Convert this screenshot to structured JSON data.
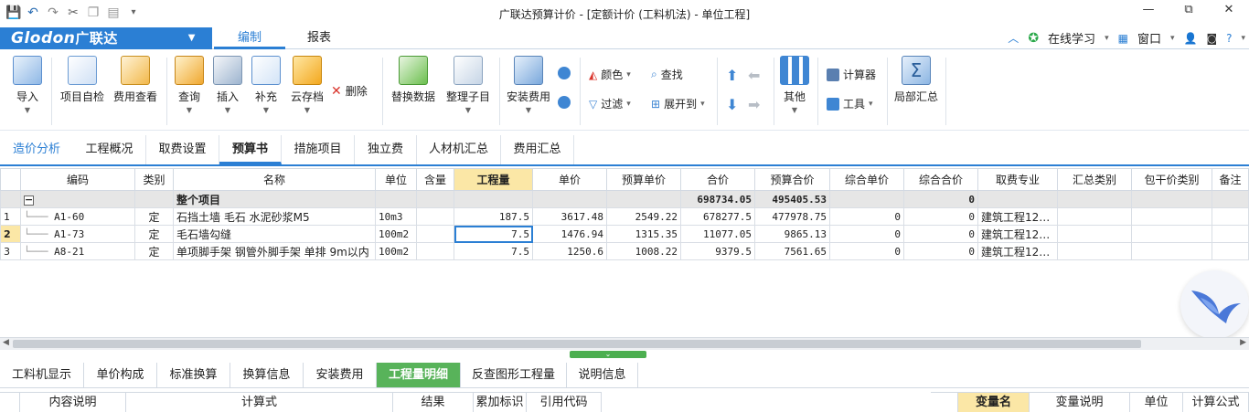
{
  "title": {
    "text": "广联达预算计价 - [定额计价 (工料机法) - 单位工程]",
    "win_min": "—",
    "win_restore": "⧉",
    "win_close": "✕"
  },
  "menubar": {
    "logo": "Glodon",
    "logo_cn": "广联达",
    "tabs": [
      "编制",
      "报表"
    ],
    "online_learning": "在线学习",
    "window": "窗口"
  },
  "ribbon": {
    "import": "导入",
    "self_check": "项目自检",
    "fee_view": "费用查看",
    "query": "查询",
    "insert": "插入",
    "supplement": "补充",
    "cloud_save": "云存档",
    "delete": "删除",
    "replace_data": "替换数据",
    "organize": "整理子目",
    "install_fee": "安装费用",
    "color": "颜色",
    "find": "查找",
    "filter": "过滤",
    "expand_to": "展开到",
    "other": "其他",
    "calculator": "计算器",
    "tools": "工具",
    "partial_summary": "局部汇总"
  },
  "nav_tabs": [
    "造价分析",
    "工程概况",
    "取费设置",
    "预算书",
    "措施项目",
    "独立费",
    "人材机汇总",
    "费用汇总"
  ],
  "grid": {
    "columns": [
      "编码",
      "类别",
      "名称",
      "单位",
      "含量",
      "工程量",
      "单价",
      "预算单价",
      "合价",
      "预算合价",
      "综合单价",
      "综合合价",
      "取费专业",
      "汇总类别",
      "包干价类别",
      "备注"
    ],
    "group_row": {
      "name": "整个项目",
      "total": "698734.05",
      "budget_total": "495405.53",
      "comp_total": "0"
    },
    "rows": [
      {
        "no": "1",
        "code": "A1-60",
        "type": "定",
        "name": "石挡土墙 毛石 水泥砂浆M5",
        "unit": "10m3",
        "qty": "187.5",
        "price": "3617.48",
        "budget_price": "2549.22",
        "total": "678277.5",
        "budget_total": "477978.75",
        "comp_price": "0",
        "comp_total": "0",
        "profession": "建筑工程12…"
      },
      {
        "no": "2",
        "code": "A1-73",
        "type": "定",
        "name": "毛石墙勾缝",
        "unit": "100m2",
        "qty": "7.5",
        "price": "1476.94",
        "budget_price": "1315.35",
        "total": "11077.05",
        "budget_total": "9865.13",
        "comp_price": "0",
        "comp_total": "0",
        "profession": "建筑工程12…"
      },
      {
        "no": "3",
        "code": "A8-21",
        "type": "定",
        "name": "单项脚手架 钢管外脚手架 单排 9m以内",
        "unit": "100m2",
        "qty": "7.5",
        "price": "1250.6",
        "budget_price": "1008.22",
        "total": "9379.5",
        "budget_total": "7561.65",
        "comp_price": "0",
        "comp_total": "0",
        "profession": "建筑工程12…"
      }
    ]
  },
  "bottom_tabs": [
    "工料机显示",
    "单价构成",
    "标准换算",
    "换算信息",
    "安装费用",
    "工程量明细",
    "反查图形工程量",
    "说明信息"
  ],
  "bottom_left_headers": [
    "内容说明",
    "计算式",
    "结果",
    "累加标识",
    "引用代码"
  ],
  "bottom_right_headers": [
    "变量名",
    "变量说明",
    "单位",
    "计算公式"
  ]
}
